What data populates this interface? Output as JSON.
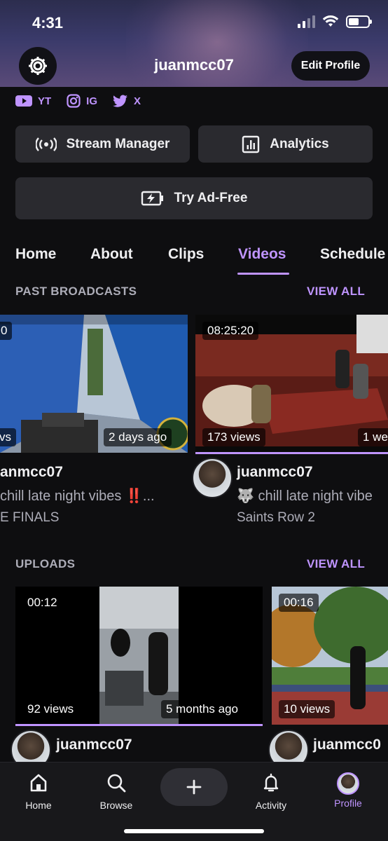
{
  "status_bar": {
    "time": "4:31"
  },
  "header": {
    "username": "juanmcc07",
    "edit_profile_label": "Edit Profile"
  },
  "socials": [
    {
      "icon": "youtube-icon",
      "label": "YT"
    },
    {
      "icon": "instagram-icon",
      "label": "IG"
    },
    {
      "icon": "twitter-icon",
      "label": "X"
    }
  ],
  "actions": {
    "stream_manager": "Stream Manager",
    "analytics": "Analytics",
    "try_ad_free": "Try Ad-Free"
  },
  "tabs": [
    "Home",
    "About",
    "Clips",
    "Videos",
    "Schedule"
  ],
  "active_tab": "Videos",
  "past_broadcasts": {
    "title": "PAST BROADCASTS",
    "view_all": "VIEW ALL",
    "cards": [
      {
        "duration": "0",
        "views": "vs",
        "age": "2 days ago",
        "channel": "anmcc07",
        "title": " chill late night vibes ‼️...",
        "game": "E FINALS"
      },
      {
        "duration": "08:25:20",
        "views": "173 views",
        "age": "1 we",
        "channel": "juanmcc07",
        "title": "🐺 chill late night vibe",
        "game": "Saints Row 2"
      }
    ]
  },
  "uploads": {
    "title": "UPLOADS",
    "view_all": "VIEW ALL",
    "cards": [
      {
        "duration": "00:12",
        "views": "92 views",
        "age": "5 months ago",
        "channel": "juanmcc07"
      },
      {
        "duration": "00:16",
        "views": "10 views",
        "channel": "juanmcc0"
      }
    ]
  },
  "bottom_nav": {
    "home": "Home",
    "browse": "Browse",
    "activity": "Activity",
    "profile": "Profile"
  },
  "colors": {
    "accent": "#bf94ff",
    "background": "#0e0e10",
    "button": "#2a2a2f"
  }
}
